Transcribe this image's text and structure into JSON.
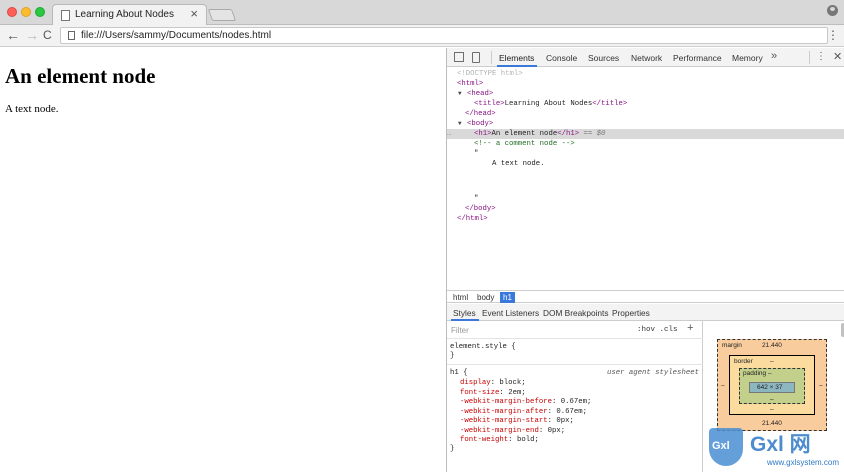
{
  "window": {
    "tab_title": "Learning About Nodes",
    "tab_close": "×"
  },
  "toolbar": {
    "back": "←",
    "forward": "→",
    "reload": "C",
    "url": "file:///Users/sammy/Documents/nodes.html",
    "menu": "⋮"
  },
  "page": {
    "heading": "An element node",
    "paragraph": "A text node."
  },
  "devtools": {
    "tabs": [
      "Elements",
      "Console",
      "Sources",
      "Network",
      "Performance",
      "Memory"
    ],
    "active_tab": "Elements",
    "more": "»",
    "kebab": "⋮",
    "close": "✕",
    "dom": {
      "doctype": "<!DOCTYPE html>",
      "html_open": "<html>",
      "head_open": "<head>",
      "title_open": "<title>",
      "title_text": "Learning About Nodes",
      "title_close": "</title>",
      "head_close": "</head>",
      "body_open": "<body>",
      "h1_open": "<h1>",
      "h1_text": "An element node",
      "h1_close": "</h1>",
      "h1_marker": " == $0",
      "ellipsis": "…",
      "comment": "<!-- a comment node -->",
      "quote1": "\"",
      "text_node": "A text node.",
      "quote2": "\"",
      "body_close": "</body>",
      "html_close": "</html>"
    },
    "breadcrumbs": [
      "html",
      "body",
      "h1"
    ],
    "styles_tabs": [
      "Styles",
      "Event Listeners",
      "DOM Breakpoints",
      "Properties"
    ],
    "filter_placeholder": "Filter",
    "hov_cls": ":hov .cls",
    "plus": "+",
    "element_style": "element.style {",
    "element_style_close": "}",
    "h1_rule": {
      "selector": "h1 {",
      "source": "user agent stylesheet",
      "declarations": [
        {
          "prop": "display",
          "value": "block;"
        },
        {
          "prop": "font-size",
          "value": "2em;"
        },
        {
          "prop": "-webkit-margin-before",
          "value": "0.67em;"
        },
        {
          "prop": "-webkit-margin-after",
          "value": "0.67em;"
        },
        {
          "prop": "-webkit-margin-start",
          "value": "0px;"
        },
        {
          "prop": "-webkit-margin-end",
          "value": "0px;"
        },
        {
          "prop": "font-weight",
          "value": "bold;"
        }
      ],
      "close": "}"
    },
    "box_model": {
      "margin_label": "margin",
      "margin_top": "21.440",
      "margin_bottom": "21.440",
      "border_label": "border",
      "border_value": "–",
      "border_bottom": "–",
      "padding_label": "padding –",
      "padding_bottom": "–",
      "content": "642 × 37",
      "side_left": "–",
      "side_right": "–"
    }
  },
  "watermark": {
    "shield_text": "Gxl",
    "big_text": "Gxl 网",
    "small_text": "www.gxlsystem.com"
  }
}
